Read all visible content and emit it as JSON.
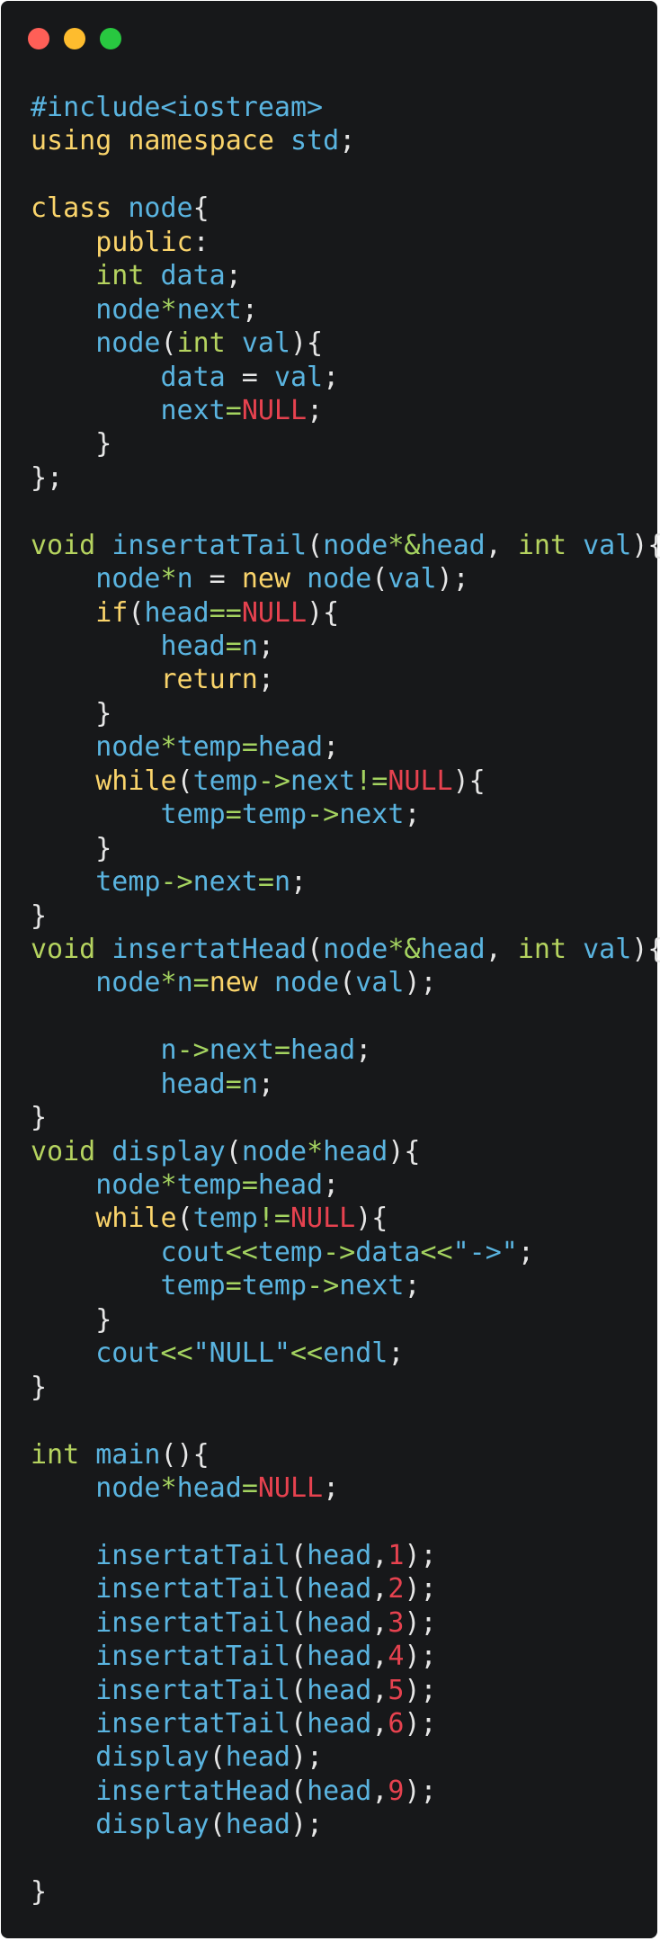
{
  "window": {
    "controls": [
      {
        "name": "close",
        "color": "#ff5f57"
      },
      {
        "name": "minimize",
        "color": "#febc2e"
      },
      {
        "name": "zoom",
        "color": "#28c840"
      }
    ]
  },
  "colors": {
    "background": "#17181a",
    "default": "#e6e6e6",
    "keyword": "#fad46b",
    "type": "#b5d35f",
    "identifier": "#5ab4e0",
    "operator": "#a4d360",
    "null": "#e6424f",
    "number": "#e6424f",
    "string": "#5ab4e0"
  },
  "code_lines": [
    [
      [
        "#include<iostream>",
        "identifier"
      ]
    ],
    [
      [
        "using",
        "keyword"
      ],
      [
        " ",
        "default"
      ],
      [
        "namespace",
        "keyword"
      ],
      [
        " ",
        "default"
      ],
      [
        "std",
        "identifier"
      ],
      [
        ";",
        "default"
      ]
    ],
    [],
    [
      [
        "class",
        "keyword"
      ],
      [
        " ",
        "default"
      ],
      [
        "node",
        "identifier"
      ],
      [
        "{",
        "default"
      ]
    ],
    [
      [
        "    ",
        "default"
      ],
      [
        "public",
        "keyword"
      ],
      [
        ":",
        "default"
      ]
    ],
    [
      [
        "    ",
        "default"
      ],
      [
        "int",
        "type"
      ],
      [
        " ",
        "default"
      ],
      [
        "data",
        "identifier"
      ],
      [
        ";",
        "default"
      ]
    ],
    [
      [
        "    ",
        "default"
      ],
      [
        "node",
        "identifier"
      ],
      [
        "*",
        "operator"
      ],
      [
        "next",
        "identifier"
      ],
      [
        ";",
        "default"
      ]
    ],
    [
      [
        "    ",
        "default"
      ],
      [
        "node",
        "identifier"
      ],
      [
        "(",
        "default"
      ],
      [
        "int",
        "type"
      ],
      [
        " ",
        "default"
      ],
      [
        "val",
        "identifier"
      ],
      [
        "){",
        "default"
      ]
    ],
    [
      [
        "        ",
        "default"
      ],
      [
        "data",
        "identifier"
      ],
      [
        " = ",
        "default"
      ],
      [
        "val",
        "identifier"
      ],
      [
        ";",
        "default"
      ]
    ],
    [
      [
        "        ",
        "default"
      ],
      [
        "next",
        "identifier"
      ],
      [
        "=",
        "operator"
      ],
      [
        "NULL",
        "null"
      ],
      [
        ";",
        "default"
      ]
    ],
    [
      [
        "    ",
        "default"
      ],
      [
        "}",
        "default"
      ]
    ],
    [
      [
        "};",
        "default"
      ]
    ],
    [],
    [
      [
        "void",
        "type"
      ],
      [
        " ",
        "default"
      ],
      [
        "insertatTail",
        "identifier"
      ],
      [
        "(",
        "default"
      ],
      [
        "node",
        "identifier"
      ],
      [
        "*&",
        "operator"
      ],
      [
        "head",
        "identifier"
      ],
      [
        ", ",
        "default"
      ],
      [
        "int",
        "type"
      ],
      [
        " ",
        "default"
      ],
      [
        "val",
        "identifier"
      ],
      [
        "){",
        "default"
      ]
    ],
    [
      [
        "    ",
        "default"
      ],
      [
        "node",
        "identifier"
      ],
      [
        "*",
        "operator"
      ],
      [
        "n",
        "identifier"
      ],
      [
        " = ",
        "default"
      ],
      [
        "new",
        "keyword"
      ],
      [
        " ",
        "default"
      ],
      [
        "node",
        "identifier"
      ],
      [
        "(",
        "default"
      ],
      [
        "val",
        "identifier"
      ],
      [
        ");",
        "default"
      ]
    ],
    [
      [
        "    ",
        "default"
      ],
      [
        "if",
        "keyword"
      ],
      [
        "(",
        "default"
      ],
      [
        "head",
        "identifier"
      ],
      [
        "==",
        "operator"
      ],
      [
        "NULL",
        "null"
      ],
      [
        "){",
        "default"
      ]
    ],
    [
      [
        "        ",
        "default"
      ],
      [
        "head",
        "identifier"
      ],
      [
        "=",
        "operator"
      ],
      [
        "n",
        "identifier"
      ],
      [
        ";",
        "default"
      ]
    ],
    [
      [
        "        ",
        "default"
      ],
      [
        "return",
        "keyword"
      ],
      [
        ";",
        "default"
      ]
    ],
    [
      [
        "    ",
        "default"
      ],
      [
        "}",
        "default"
      ]
    ],
    [
      [
        "    ",
        "default"
      ],
      [
        "node",
        "identifier"
      ],
      [
        "*",
        "operator"
      ],
      [
        "temp",
        "identifier"
      ],
      [
        "=",
        "operator"
      ],
      [
        "head",
        "identifier"
      ],
      [
        ";",
        "default"
      ]
    ],
    [
      [
        "    ",
        "default"
      ],
      [
        "while",
        "keyword"
      ],
      [
        "(",
        "default"
      ],
      [
        "temp",
        "identifier"
      ],
      [
        "->",
        "operator"
      ],
      [
        "next",
        "identifier"
      ],
      [
        "!=",
        "operator"
      ],
      [
        "NULL",
        "null"
      ],
      [
        "){",
        "default"
      ]
    ],
    [
      [
        "        ",
        "default"
      ],
      [
        "temp",
        "identifier"
      ],
      [
        "=",
        "operator"
      ],
      [
        "temp",
        "identifier"
      ],
      [
        "->",
        "operator"
      ],
      [
        "next",
        "identifier"
      ],
      [
        ";",
        "default"
      ]
    ],
    [
      [
        "    ",
        "default"
      ],
      [
        "}",
        "default"
      ]
    ],
    [
      [
        "    ",
        "default"
      ],
      [
        "temp",
        "identifier"
      ],
      [
        "->",
        "operator"
      ],
      [
        "next",
        "identifier"
      ],
      [
        "=",
        "operator"
      ],
      [
        "n",
        "identifier"
      ],
      [
        ";",
        "default"
      ]
    ],
    [
      [
        "}",
        "default"
      ]
    ],
    [
      [
        "void",
        "type"
      ],
      [
        " ",
        "default"
      ],
      [
        "insertatHead",
        "identifier"
      ],
      [
        "(",
        "default"
      ],
      [
        "node",
        "identifier"
      ],
      [
        "*&",
        "operator"
      ],
      [
        "head",
        "identifier"
      ],
      [
        ", ",
        "default"
      ],
      [
        "int",
        "type"
      ],
      [
        " ",
        "default"
      ],
      [
        "val",
        "identifier"
      ],
      [
        "){",
        "default"
      ]
    ],
    [
      [
        "    ",
        "default"
      ],
      [
        "node",
        "identifier"
      ],
      [
        "*",
        "operator"
      ],
      [
        "n",
        "identifier"
      ],
      [
        "=",
        "operator"
      ],
      [
        "new",
        "keyword"
      ],
      [
        " ",
        "default"
      ],
      [
        "node",
        "identifier"
      ],
      [
        "(",
        "default"
      ],
      [
        "val",
        "identifier"
      ],
      [
        ");",
        "default"
      ]
    ],
    [],
    [
      [
        "        ",
        "default"
      ],
      [
        "n",
        "identifier"
      ],
      [
        "->",
        "operator"
      ],
      [
        "next",
        "identifier"
      ],
      [
        "=",
        "operator"
      ],
      [
        "head",
        "identifier"
      ],
      [
        ";",
        "default"
      ]
    ],
    [
      [
        "        ",
        "default"
      ],
      [
        "head",
        "identifier"
      ],
      [
        "=",
        "operator"
      ],
      [
        "n",
        "identifier"
      ],
      [
        ";",
        "default"
      ]
    ],
    [
      [
        "}",
        "default"
      ]
    ],
    [
      [
        "void",
        "type"
      ],
      [
        " ",
        "default"
      ],
      [
        "display",
        "identifier"
      ],
      [
        "(",
        "default"
      ],
      [
        "node",
        "identifier"
      ],
      [
        "*",
        "operator"
      ],
      [
        "head",
        "identifier"
      ],
      [
        "){",
        "default"
      ]
    ],
    [
      [
        "    ",
        "default"
      ],
      [
        "node",
        "identifier"
      ],
      [
        "*",
        "operator"
      ],
      [
        "temp",
        "identifier"
      ],
      [
        "=",
        "operator"
      ],
      [
        "head",
        "identifier"
      ],
      [
        ";",
        "default"
      ]
    ],
    [
      [
        "    ",
        "default"
      ],
      [
        "while",
        "keyword"
      ],
      [
        "(",
        "default"
      ],
      [
        "temp",
        "identifier"
      ],
      [
        "!=",
        "operator"
      ],
      [
        "NULL",
        "null"
      ],
      [
        "){",
        "default"
      ]
    ],
    [
      [
        "        ",
        "default"
      ],
      [
        "cout",
        "identifier"
      ],
      [
        "<<",
        "operator"
      ],
      [
        "temp",
        "identifier"
      ],
      [
        "->",
        "operator"
      ],
      [
        "data",
        "identifier"
      ],
      [
        "<<",
        "operator"
      ],
      [
        "\"->\"",
        "string"
      ],
      [
        ";",
        "default"
      ]
    ],
    [
      [
        "        ",
        "default"
      ],
      [
        "temp",
        "identifier"
      ],
      [
        "=",
        "operator"
      ],
      [
        "temp",
        "identifier"
      ],
      [
        "->",
        "operator"
      ],
      [
        "next",
        "identifier"
      ],
      [
        ";",
        "default"
      ]
    ],
    [
      [
        "    ",
        "default"
      ],
      [
        "}",
        "default"
      ]
    ],
    [
      [
        "    ",
        "default"
      ],
      [
        "cout",
        "identifier"
      ],
      [
        "<<",
        "operator"
      ],
      [
        "\"NULL\"",
        "string"
      ],
      [
        "<<",
        "operator"
      ],
      [
        "endl",
        "identifier"
      ],
      [
        ";",
        "default"
      ]
    ],
    [
      [
        "}",
        "default"
      ]
    ],
    [],
    [
      [
        "int",
        "type"
      ],
      [
        " ",
        "default"
      ],
      [
        "main",
        "identifier"
      ],
      [
        "(){",
        "default"
      ]
    ],
    [
      [
        "    ",
        "default"
      ],
      [
        "node",
        "identifier"
      ],
      [
        "*",
        "operator"
      ],
      [
        "head",
        "identifier"
      ],
      [
        "=",
        "operator"
      ],
      [
        "NULL",
        "null"
      ],
      [
        ";",
        "default"
      ]
    ],
    [],
    [
      [
        "    ",
        "default"
      ],
      [
        "insertatTail",
        "identifier"
      ],
      [
        "(",
        "default"
      ],
      [
        "head",
        "identifier"
      ],
      [
        ",",
        "default"
      ],
      [
        "1",
        "number"
      ],
      [
        ");",
        "default"
      ]
    ],
    [
      [
        "    ",
        "default"
      ],
      [
        "insertatTail",
        "identifier"
      ],
      [
        "(",
        "default"
      ],
      [
        "head",
        "identifier"
      ],
      [
        ",",
        "default"
      ],
      [
        "2",
        "number"
      ],
      [
        ");",
        "default"
      ]
    ],
    [
      [
        "    ",
        "default"
      ],
      [
        "insertatTail",
        "identifier"
      ],
      [
        "(",
        "default"
      ],
      [
        "head",
        "identifier"
      ],
      [
        ",",
        "default"
      ],
      [
        "3",
        "number"
      ],
      [
        ");",
        "default"
      ]
    ],
    [
      [
        "    ",
        "default"
      ],
      [
        "insertatTail",
        "identifier"
      ],
      [
        "(",
        "default"
      ],
      [
        "head",
        "identifier"
      ],
      [
        ",",
        "default"
      ],
      [
        "4",
        "number"
      ],
      [
        ");",
        "default"
      ]
    ],
    [
      [
        "    ",
        "default"
      ],
      [
        "insertatTail",
        "identifier"
      ],
      [
        "(",
        "default"
      ],
      [
        "head",
        "identifier"
      ],
      [
        ",",
        "default"
      ],
      [
        "5",
        "number"
      ],
      [
        ");",
        "default"
      ]
    ],
    [
      [
        "    ",
        "default"
      ],
      [
        "insertatTail",
        "identifier"
      ],
      [
        "(",
        "default"
      ],
      [
        "head",
        "identifier"
      ],
      [
        ",",
        "default"
      ],
      [
        "6",
        "number"
      ],
      [
        ");",
        "default"
      ]
    ],
    [
      [
        "    ",
        "default"
      ],
      [
        "display",
        "identifier"
      ],
      [
        "(",
        "default"
      ],
      [
        "head",
        "identifier"
      ],
      [
        ");",
        "default"
      ]
    ],
    [
      [
        "    ",
        "default"
      ],
      [
        "insertatHead",
        "identifier"
      ],
      [
        "(",
        "default"
      ],
      [
        "head",
        "identifier"
      ],
      [
        ",",
        "default"
      ],
      [
        "9",
        "number"
      ],
      [
        ");",
        "default"
      ]
    ],
    [
      [
        "    ",
        "default"
      ],
      [
        "display",
        "identifier"
      ],
      [
        "(",
        "default"
      ],
      [
        "head",
        "identifier"
      ],
      [
        ");",
        "default"
      ]
    ],
    [],
    [
      [
        "}",
        "default"
      ]
    ]
  ]
}
